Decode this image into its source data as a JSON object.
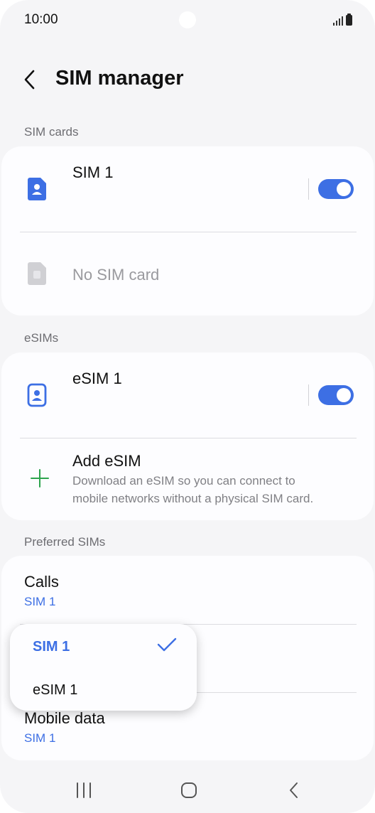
{
  "status_bar": {
    "time": "10:00"
  },
  "header": {
    "title": "SIM manager"
  },
  "sim_cards": {
    "section_label": "SIM cards",
    "items": [
      {
        "name": "SIM 1",
        "enabled": true
      },
      {
        "name": "No SIM card"
      }
    ]
  },
  "esims": {
    "section_label": "eSIMs",
    "items": [
      {
        "name": "eSIM 1",
        "enabled": true
      }
    ],
    "add": {
      "title": "Add eSIM",
      "description_line1": "Download an eSIM so you can connect to",
      "description_line2": "mobile networks without a physical SIM card."
    }
  },
  "preferred": {
    "section_label": "Preferred SIMs",
    "calls": {
      "title": "Calls",
      "value": "SIM 1"
    },
    "mobile_data": {
      "title": "Mobile data",
      "value": "SIM 1"
    }
  },
  "popup": {
    "options": [
      {
        "label": "SIM 1",
        "selected": true
      },
      {
        "label": "eSIM 1",
        "selected": false
      }
    ]
  },
  "colors": {
    "accent": "#3d6fe4",
    "add_icon": "#2da44e",
    "background": "#f5f5f7"
  },
  "icons": {
    "back": "chevron-left-icon",
    "sim": "sim-card-icon",
    "add": "plus-icon",
    "check": "check-icon",
    "nav": [
      "recent-apps-icon",
      "home-icon",
      "back-icon"
    ]
  }
}
